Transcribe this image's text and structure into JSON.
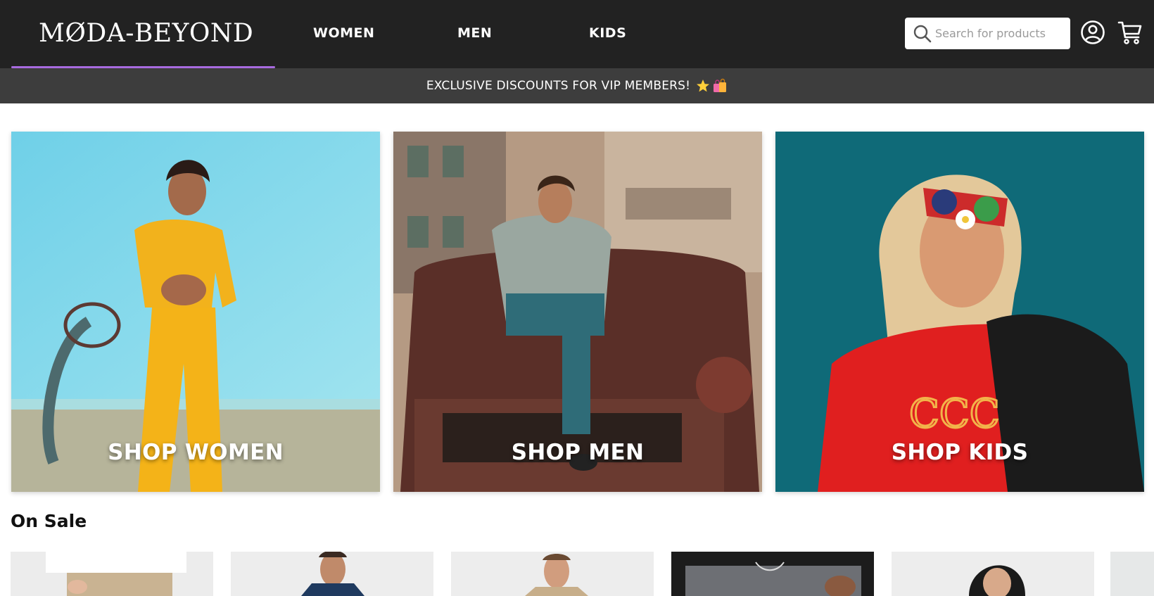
{
  "brand": {
    "logo_text": "MØDA-BEYOND"
  },
  "nav": {
    "items": [
      {
        "label": "WOMEN"
      },
      {
        "label": "MEN"
      },
      {
        "label": "KIDS"
      }
    ]
  },
  "search": {
    "placeholder": "Search for products",
    "value": ""
  },
  "header_icons": [
    "account-icon",
    "cart-icon"
  ],
  "promo": {
    "text": "EXCLUSIVE DISCOUNTS FOR VIP MEMBERS!",
    "emojis": [
      "star-icon",
      "shopping-bags-icon"
    ]
  },
  "categories": [
    {
      "label": "SHOP WOMEN"
    },
    {
      "label": "SHOP MEN"
    },
    {
      "label": "SHOP KIDS"
    }
  ],
  "on_sale": {
    "title": "On Sale",
    "products": [
      {
        "image": "product-image-beige-pants"
      },
      {
        "image": "product-image-navy-shirt"
      },
      {
        "image": "product-image-beige-jacket"
      },
      {
        "image": "product-image-gray-shorts"
      },
      {
        "image": "product-image-black-top"
      },
      {
        "image": "product-image-partial"
      }
    ]
  },
  "colors": {
    "header_bg": "#222222",
    "promo_bg": "#3d3d3d",
    "accent_underline": "#a86bdf",
    "text_on_dark": "#ffffff"
  }
}
